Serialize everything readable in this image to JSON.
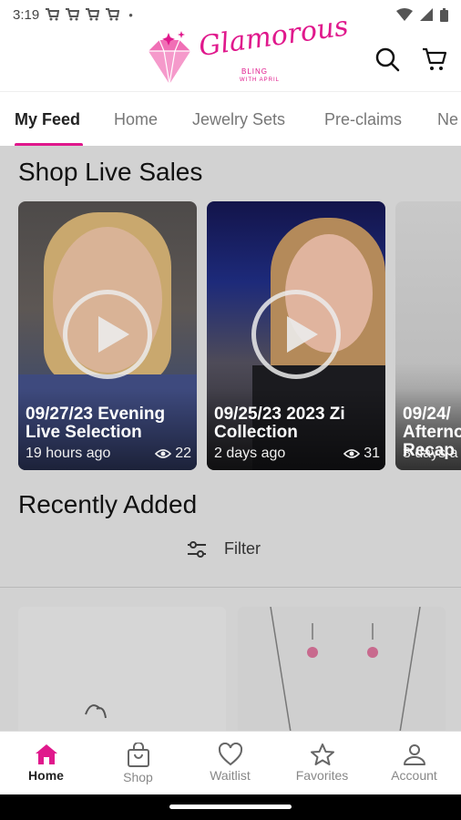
{
  "status": {
    "time": "3:19"
  },
  "header": {
    "logo_line1": "Glamorous",
    "logo_line2": "BLING",
    "logo_line3": "WITH APRIL"
  },
  "tabs": [
    {
      "label": "My Feed"
    },
    {
      "label": "Home"
    },
    {
      "label": "Jewelry Sets"
    },
    {
      "label": "Pre-claims"
    },
    {
      "label": "Ne"
    }
  ],
  "live": {
    "section_title": "Shop Live Sales",
    "cards": [
      {
        "title": "09/27/23 Evening Live Selection",
        "age": "19 hours ago",
        "views": "22"
      },
      {
        "title": "09/25/23 2023 Zi Collection",
        "age": "2 days ago",
        "views": "31"
      },
      {
        "title": "09/24/ Afterno Recap",
        "age": "3 days a",
        "views": ""
      }
    ]
  },
  "recent": {
    "section_title": "Recently Added",
    "filter_label": "Filter"
  },
  "bottom_nav": [
    {
      "label": "Home",
      "icon": "home-icon"
    },
    {
      "label": "Shop",
      "icon": "shopping-bag-icon"
    },
    {
      "label": "Waitlist",
      "icon": "heart-icon"
    },
    {
      "label": "Favorites",
      "icon": "star-icon"
    },
    {
      "label": "Account",
      "icon": "person-icon"
    }
  ],
  "colors": {
    "accent": "#e0188c"
  }
}
